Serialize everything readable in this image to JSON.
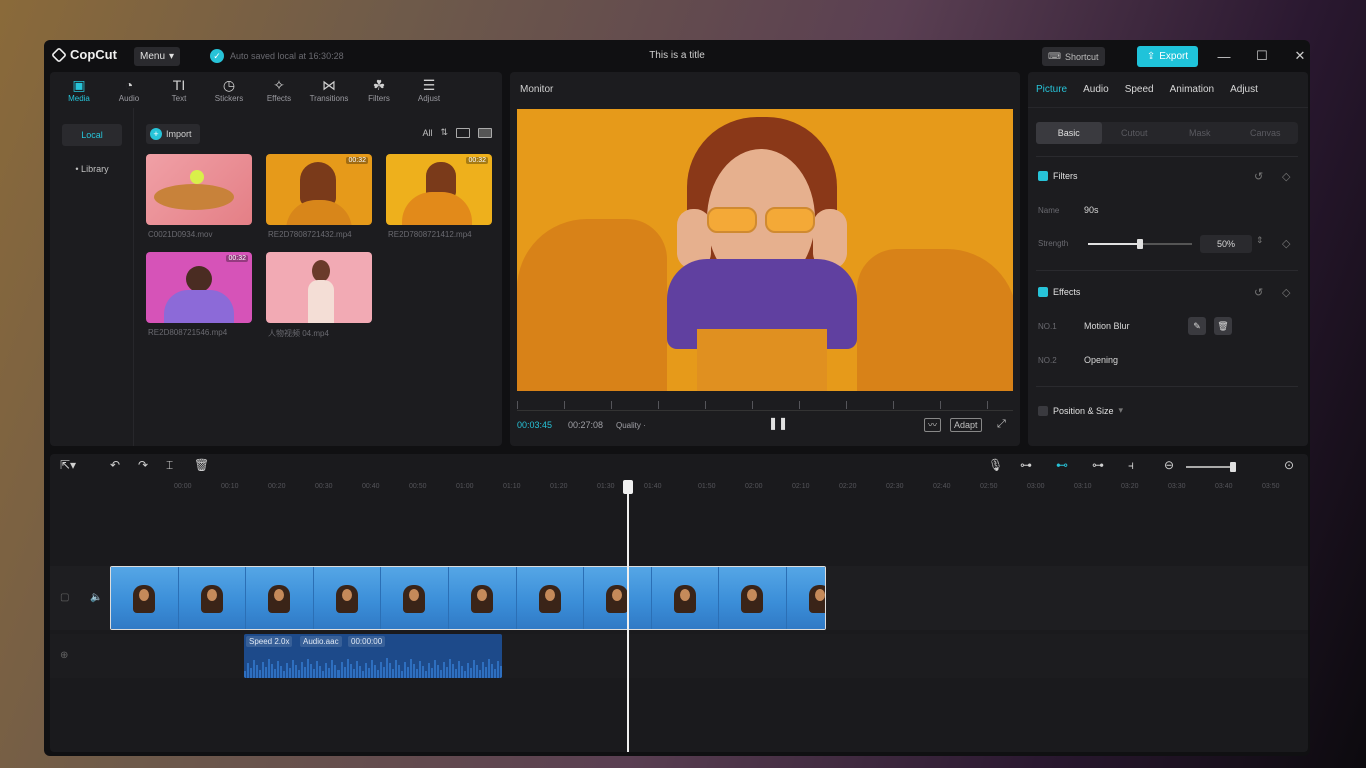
{
  "app": {
    "name": "CopCut",
    "menu": "Menu",
    "autosave": "Auto saved local at 16:30:28",
    "title": "This is a title",
    "shortcut": "Shortcut",
    "export": "Export"
  },
  "media_tabs": [
    {
      "label": "Media",
      "icon": "media-icon"
    },
    {
      "label": "Audio",
      "icon": "audio-icon"
    },
    {
      "label": "Text",
      "icon": "text-icon"
    },
    {
      "label": "Stickers",
      "icon": "stickers-icon"
    },
    {
      "label": "Effects",
      "icon": "effects-icon"
    },
    {
      "label": "Transitions",
      "icon": "transitions-icon"
    },
    {
      "label": "Filters",
      "icon": "filters-icon"
    },
    {
      "label": "Adjust",
      "icon": "adjust-icon"
    }
  ],
  "media_side": {
    "local": "Local",
    "library": "• Library"
  },
  "media_toolbar": {
    "import": "Import",
    "filter": "All"
  },
  "media_items": [
    {
      "name": "C0021D0934.mov",
      "duration": ""
    },
    {
      "name": "RE2D7808721432.mp4",
      "duration": "00:32"
    },
    {
      "name": "RE2D7808721412.mp4",
      "duration": "00:32"
    },
    {
      "name": "RE2D808721546.mp4",
      "duration": "00:32"
    },
    {
      "name": "人物视频 04.mp4",
      "duration": ""
    }
  ],
  "monitor": {
    "title": "Monitor",
    "current_time": "00:03:45",
    "total_time": "00:27:08",
    "quality": "Quality ·",
    "adapt": "Adapt"
  },
  "props": {
    "tabs": [
      "Picture",
      "Audio",
      "Speed",
      "Animation",
      "Adjust"
    ],
    "subtabs": [
      "Basic",
      "Cutout",
      "Mask",
      "Canvas"
    ],
    "filters_label": "Filters",
    "name_label": "Name",
    "name_value": "90s",
    "strength_label": "Strength",
    "strength_value": "50%",
    "strength_fraction": 0.5,
    "effects_label": "Effects",
    "effect1_no": "NO.1",
    "effect1": "Motion Blur",
    "effect2_no": "NO.2",
    "effect2": "Opening",
    "position_label": "Position & Size"
  },
  "timeline": {
    "ticks": [
      "00:00",
      "00:10",
      "00:20",
      "00:30",
      "00:40",
      "00:50",
      "01:00",
      "01:10",
      "01:20",
      "01:30",
      "01:40",
      "01:50",
      "02:00",
      "02:10",
      "02:20",
      "02:30",
      "02:40",
      "02:50",
      "03:00",
      "03:10",
      "03:20",
      "03:30",
      "03:40",
      "03:50"
    ],
    "audio_speed": "Speed 2.0x",
    "audio_name": "Audio.aac",
    "audio_time": "00:00:00"
  },
  "colors": {
    "accent": "#27c3d8",
    "export": "#1fc3da",
    "audio_clip": "#1d4a8a",
    "preview_bg": "#e69a1a"
  }
}
